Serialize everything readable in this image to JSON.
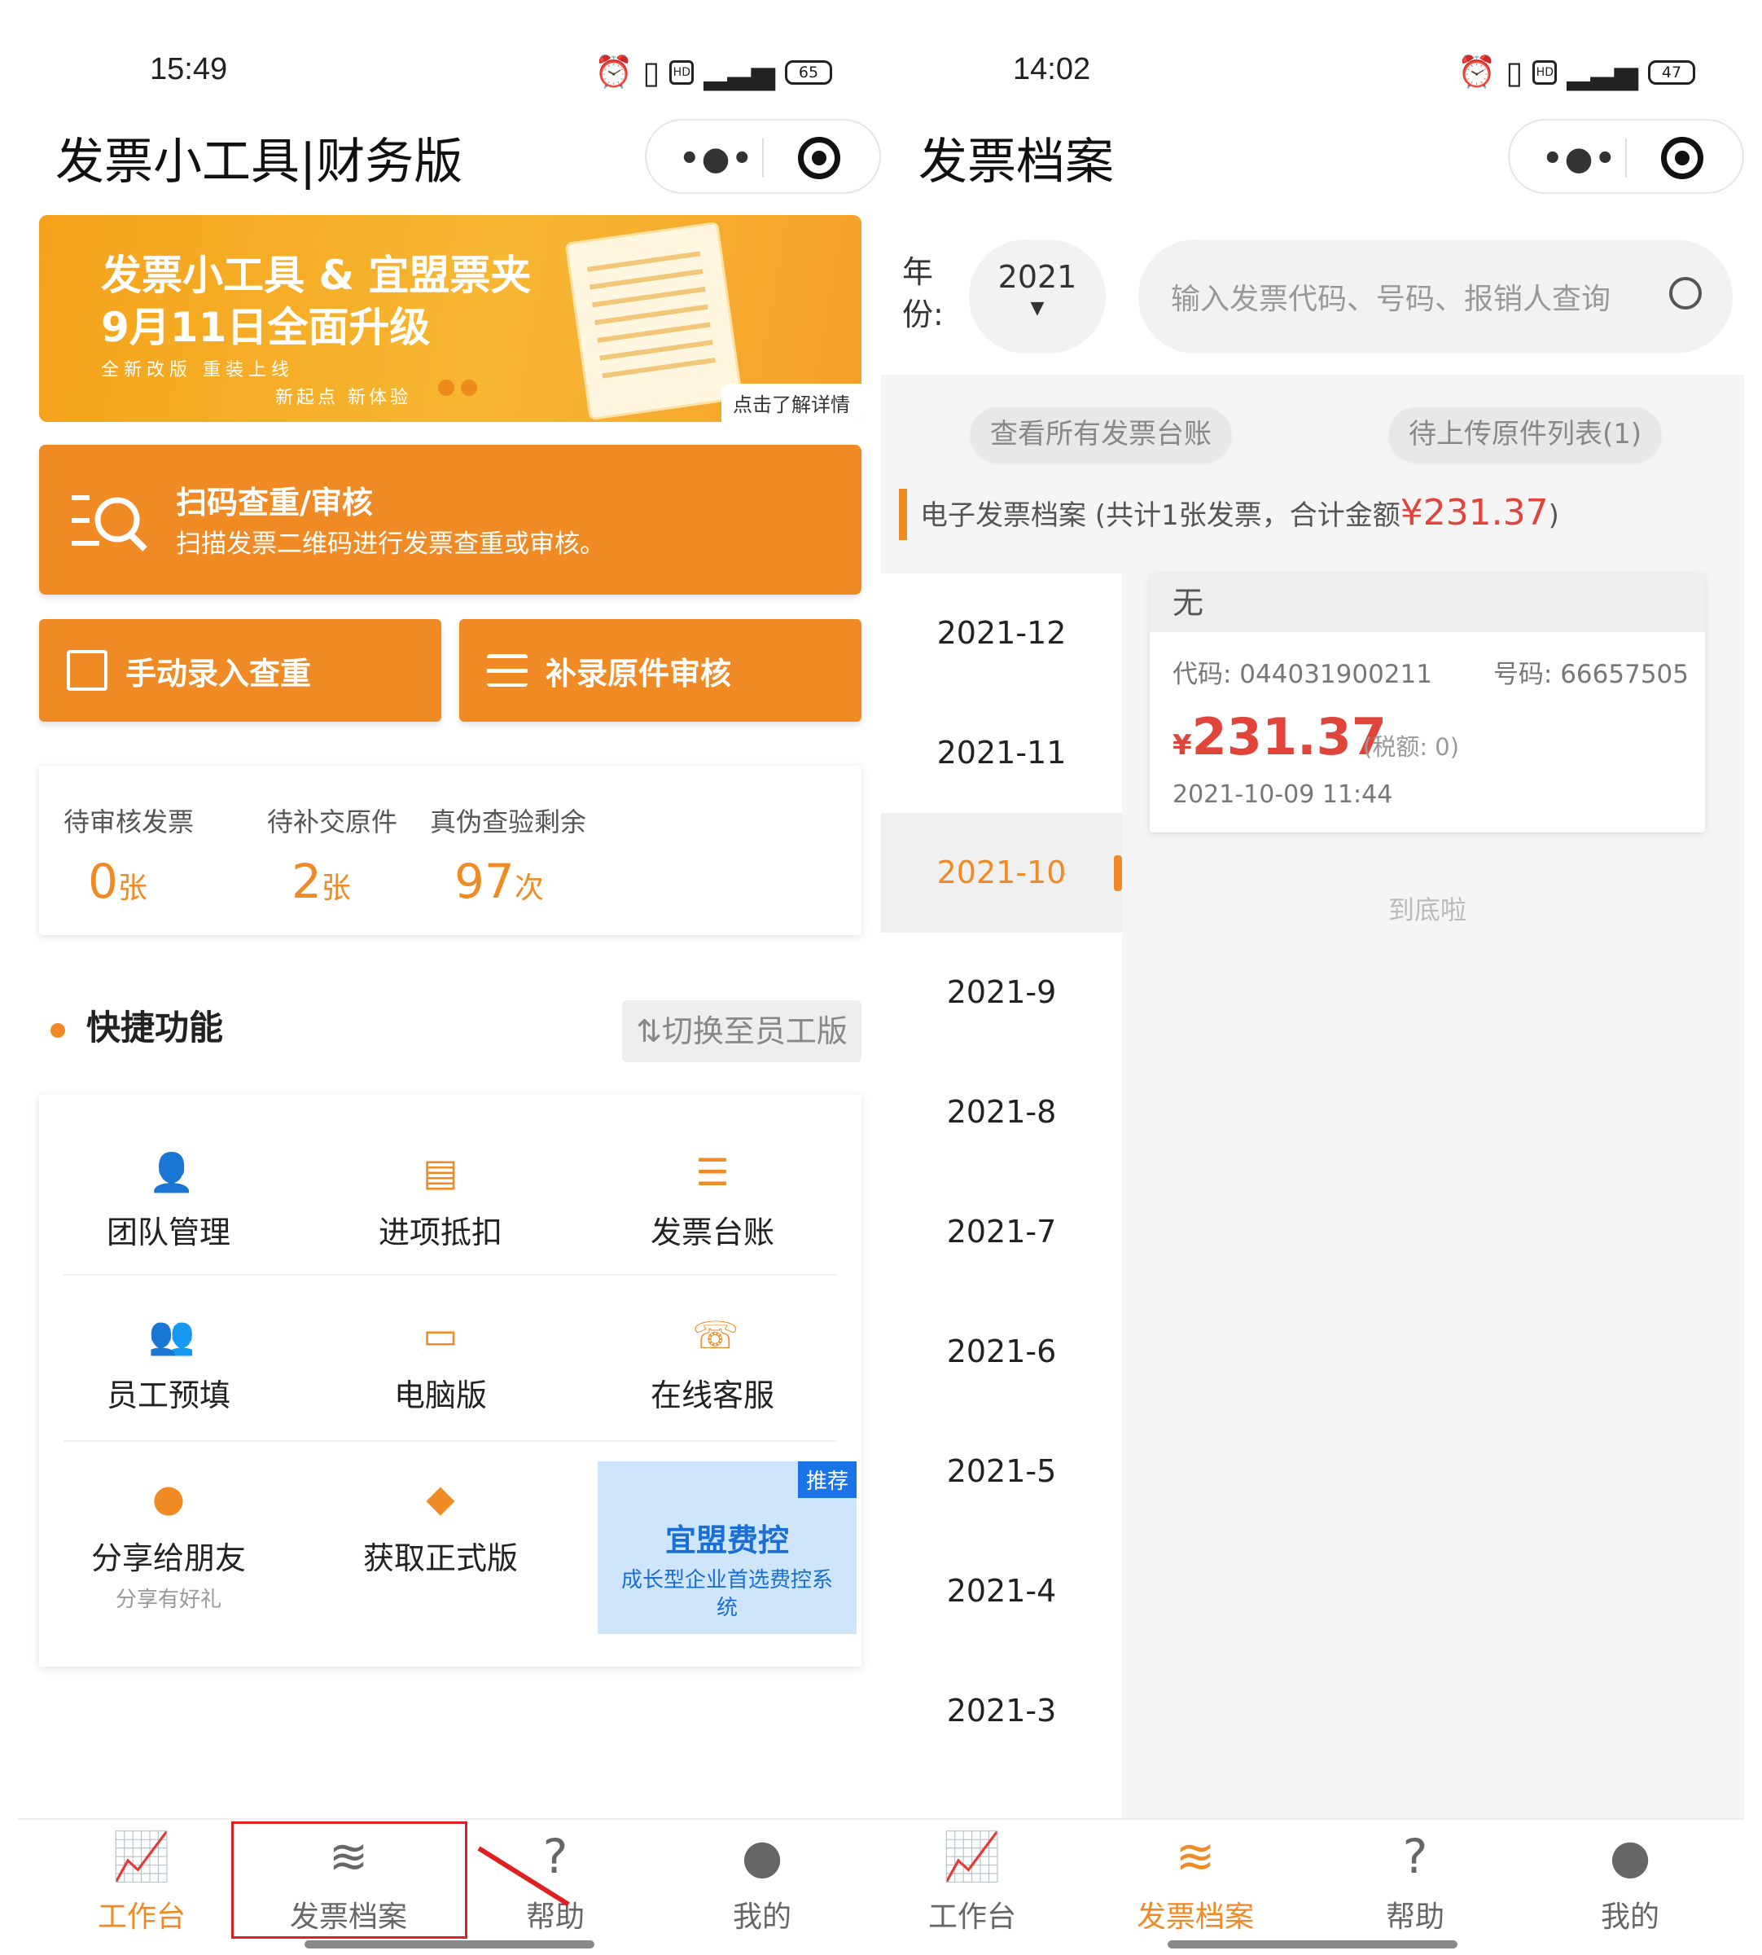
{
  "left": {
    "status": {
      "time": "15:49",
      "battery": "65"
    },
    "title": "发票小工具|财务版",
    "banner": {
      "line1": "发票小工具 & 宜盟票夹",
      "line2": "9月11日全面升级",
      "line3": "全新改版  重装上线",
      "line4": "新起点  新体验",
      "more": "点击了解详情"
    },
    "scan": {
      "title": "扫码查重/审核",
      "desc": "扫描发票二维码进行发票查重或审核。"
    },
    "manual_btn": "手动录入查重",
    "supplement_btn": "补录原件审核",
    "stats": [
      {
        "label": "待审核发票",
        "value": "0",
        "unit": "张"
      },
      {
        "label": "待补交原件",
        "value": "2",
        "unit": "张"
      },
      {
        "label": "真伪查验剩余",
        "value": "97",
        "unit": "次"
      }
    ],
    "section_title": "快捷功能",
    "switch_label": "⇅切换至员工版",
    "grid": [
      {
        "label": "团队管理",
        "icon": "team-icon"
      },
      {
        "label": "进项抵扣",
        "icon": "deduction-icon"
      },
      {
        "label": "发票台账",
        "icon": "ledger-icon"
      },
      {
        "label": "员工预填",
        "icon": "employee-icon"
      },
      {
        "label": "电脑版",
        "icon": "desktop-icon"
      },
      {
        "label": "在线客服",
        "icon": "support-icon"
      },
      {
        "label": "分享给朋友",
        "sub": "分享有好礼",
        "icon": "wechat-icon"
      },
      {
        "label": "获取正式版",
        "icon": "diamond-icon"
      }
    ],
    "promo": {
      "tag": "推荐",
      "title": "宜盟费控",
      "desc": "成长型企业首选费控系统"
    },
    "tabs": [
      "工作台",
      "发票档案",
      "帮助",
      "我的"
    ]
  },
  "right": {
    "status": {
      "time": "14:02",
      "battery": "47"
    },
    "title": "发票档案",
    "year_label": "年份:",
    "year_value": "2021",
    "search_placeholder": "输入发票代码、号码、报销人查询",
    "pill_all": "查看所有发票台账",
    "pill_pending": "待上传原件列表(1)",
    "summary_prefix": "电子发票档案 (共计1张发票，合计金额",
    "summary_amount": "¥231.37",
    "summary_suffix": ")",
    "months": [
      "2021-12",
      "2021-11",
      "2021-10",
      "2021-9",
      "2021-8",
      "2021-7",
      "2021-6",
      "2021-5",
      "2021-4",
      "2021-3"
    ],
    "active_month": "2021-10",
    "invoice": {
      "head": "无",
      "code_label": "代码: 044031900211",
      "number_label": "号码: 66657505",
      "currency": "¥",
      "amount": "231.37",
      "tax": "(税额: 0)",
      "datetime": "2021-10-09 11:44"
    },
    "end_text": "到底啦",
    "tabs": [
      "工作台",
      "发票档案",
      "帮助",
      "我的"
    ]
  },
  "colors": {
    "accent": "#f08a24",
    "price": "#e0443a",
    "promo": "#1a6fd4",
    "annotation": "#e02020"
  }
}
